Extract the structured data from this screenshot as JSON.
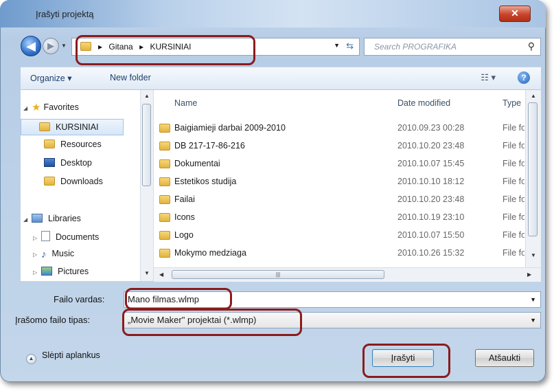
{
  "window": {
    "title": "Įrašyti projektą",
    "close_label": "✕"
  },
  "address_bar": {
    "path": [
      "Gitana",
      "KURSINIAI"
    ],
    "search_placeholder": "Search PROGRAFIKA"
  },
  "toolbar": {
    "organize_label": "Organize ▾",
    "new_folder_label": "New folder",
    "view_icon": "view-icon",
    "help_label": "?"
  },
  "nav_pane": {
    "favorites_label": "Favorites",
    "favorites": [
      "KURSINIAI",
      "Resources",
      "Desktop",
      "Downloads"
    ],
    "libraries_label": "Libraries",
    "libraries": [
      "Documents",
      "Music",
      "Pictures"
    ]
  },
  "file_list": {
    "columns": {
      "name": "Name",
      "date": "Date modified",
      "type": "Type"
    },
    "rows": [
      {
        "name": "Baigiamieji darbai 2009-2010",
        "date": "2010.09.23 00:28",
        "type": "File fol"
      },
      {
        "name": "DB 217-17-86-216",
        "date": "2010.10.20 23:48",
        "type": "File fol"
      },
      {
        "name": "Dokumentai",
        "date": "2010.10.07 15:45",
        "type": "File fol"
      },
      {
        "name": "Estetikos studija",
        "date": "2010.10.10 18:12",
        "type": "File fol"
      },
      {
        "name": "Failai",
        "date": "2010.10.20 23:48",
        "type": "File fol"
      },
      {
        "name": "Icons",
        "date": "2010.10.19 23:10",
        "type": "File fol"
      },
      {
        "name": "Logo",
        "date": "2010.10.07 15:50",
        "type": "File fol"
      },
      {
        "name": "Mokymo medziaga",
        "date": "2010.10.26 15:32",
        "type": "File fol"
      }
    ]
  },
  "save_fields": {
    "filename_label": "Failo vardas:",
    "filename_value": "Mano filmas.wlmp",
    "filetype_label": "Įrašomo failo tipas:",
    "filetype_value": "„Movie Maker\" projektai (*.wlmp)"
  },
  "footer": {
    "hide_folders_label": "Slėpti aplankus",
    "save_label": "Įrašyti",
    "cancel_label": "Atšaukti"
  },
  "colors": {
    "highlight": "#8a1c1c",
    "accent": "#3c7fb1"
  }
}
